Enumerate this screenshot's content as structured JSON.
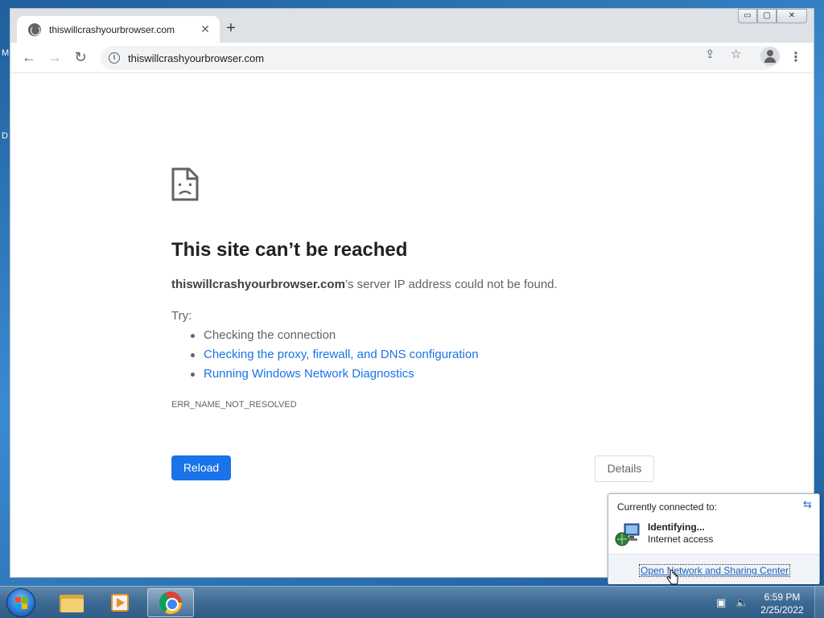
{
  "desktop": {
    "glyphs": [
      "M",
      "D"
    ]
  },
  "browser": {
    "tab": {
      "title": "thiswillcrashyourbrowser.com",
      "close_symbol": "✕"
    },
    "new_tab_symbol": "+",
    "window_controls": {
      "minimize": "▭",
      "maximize": "▢",
      "close": "✕"
    },
    "toolbar": {
      "back": "←",
      "forward": "→",
      "reload": "↻",
      "menu": "⋮"
    },
    "omnibox": {
      "url": "thiswillcrashyourbrowser.com",
      "info_symbol": "i"
    },
    "share_symbol": "⇪",
    "bookmark_symbol": "☆"
  },
  "error_page": {
    "title": "This site can’t be reached",
    "host": "thiswillcrashyourbrowser.com",
    "description_suffix": "’s server IP address could not be found.",
    "try_label": "Try:",
    "suggestions": [
      "Checking the connection",
      "Checking the proxy, firewall, and DNS configuration",
      "Running Windows Network Diagnostics"
    ],
    "error_code": "ERR_NAME_NOT_RESOLVED",
    "reload_label": "Reload",
    "details_label": "Details"
  },
  "network_flyout": {
    "header": "Currently connected to:",
    "network_name": "Identifying...",
    "network_status": "Internet access",
    "link": "Open Network and Sharing Center",
    "refresh_symbol": "⇆"
  },
  "taskbar": {
    "time": "6:59 PM",
    "date": "2/25/2022",
    "network_tray_symbol": "▣",
    "volume_tray_symbol": "🔈"
  }
}
